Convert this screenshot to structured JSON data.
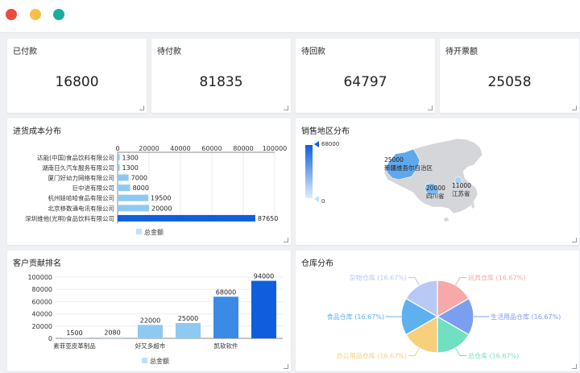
{
  "window": {
    "controls": [
      "close",
      "minimize",
      "maximize"
    ]
  },
  "kpis": [
    {
      "title": "已付款",
      "value": "16800"
    },
    {
      "title": "待付款",
      "value": "81835"
    },
    {
      "title": "待回款",
      "value": "64797"
    },
    {
      "title": "待开票额",
      "value": "25058"
    }
  ],
  "panels": {
    "purchase": {
      "title": "进货成本分布"
    },
    "region": {
      "title": "销售地区分布"
    },
    "customers": {
      "title": "客户贡献排名"
    },
    "warehouse": {
      "title": "仓库分布"
    }
  },
  "chart_data": [
    {
      "type": "bar",
      "orientation": "horizontal",
      "title": "进货成本分布",
      "categories": [
        "达能(中国)食品饮料有限公司",
        "湖南日久汽车服务有限公司",
        "厦门好幼力网络有限公司",
        "巨中进有限公司",
        "杭州娃哈哈食品有限公司",
        "北京移数通电讯有限公司",
        "深圳维他(光明)食品饮料有限公司"
      ],
      "series": [
        {
          "name": "总金额",
          "values": [
            1300,
            1300,
            7000,
            8000,
            19500,
            20000,
            87650
          ]
        }
      ],
      "xlim": [
        0,
        100000
      ],
      "xticks": [
        "0",
        "20000",
        "40000",
        "60000",
        "80000",
        "100000"
      ],
      "colors": {
        "light": "#8ec9f3",
        "highlight": "#0f5fdc"
      },
      "legend": "bottom"
    },
    {
      "type": "map",
      "title": "销售地区分布",
      "visual_range": {
        "max": "68000",
        "min": "0"
      },
      "regions": [
        {
          "name": "新疆维吾尔自治区",
          "value": "25000"
        },
        {
          "name": "四川省",
          "value": "20000"
        },
        {
          "name": "江苏省",
          "value": "11000"
        }
      ],
      "colors": {
        "low": "#dff0fb",
        "high": "#0f5fdc",
        "land": "#d4d6da"
      }
    },
    {
      "type": "bar",
      "title": "客户贡献排名",
      "categories": [
        "素菲亚皮革制品",
        "",
        "好又多超市",
        "",
        "凯软软件",
        ""
      ],
      "series": [
        {
          "name": "总金额",
          "values": [
            1500,
            2080,
            22000,
            25000,
            68000,
            94000
          ]
        }
      ],
      "data_labels": [
        "1500",
        "2080",
        "22000",
        "25000",
        "68000",
        "94000"
      ],
      "ylim": [
        0,
        100000
      ],
      "yticks": [
        "0",
        "20000",
        "40000",
        "60000",
        "80000",
        "100000"
      ],
      "colors": [
        "#bfe2f9",
        "#bfe2f9",
        "#8ec9f3",
        "#8ec9f3",
        "#3a8ae6",
        "#0f5fdc"
      ],
      "legend": "bottom"
    },
    {
      "type": "pie",
      "title": "仓库分布",
      "slices": [
        {
          "name": "玩具仓库",
          "label": "玩具仓库 (16.67%)",
          "value": 16.67,
          "color": "#f7a8a8"
        },
        {
          "name": "生活用品仓库",
          "label": "生活用品仓库 (16.67%)",
          "value": 16.67,
          "color": "#7b9ff0"
        },
        {
          "name": "总仓库",
          "label": "总仓库 (16.67%)",
          "value": 16.67,
          "color": "#70dfc2"
        },
        {
          "name": "办公用品仓库",
          "label": "办公用品仓库 (16.67%)",
          "value": 16.67,
          "color": "#f8cf7d"
        },
        {
          "name": "食品仓库",
          "label": "食品仓库 (16.67%)",
          "value": 16.67,
          "color": "#5fb0ee"
        },
        {
          "name": "杂物仓库",
          "label": "杂物仓库 (16.67%)",
          "value": 16.67,
          "color": "#b8c9f5"
        }
      ]
    }
  ]
}
